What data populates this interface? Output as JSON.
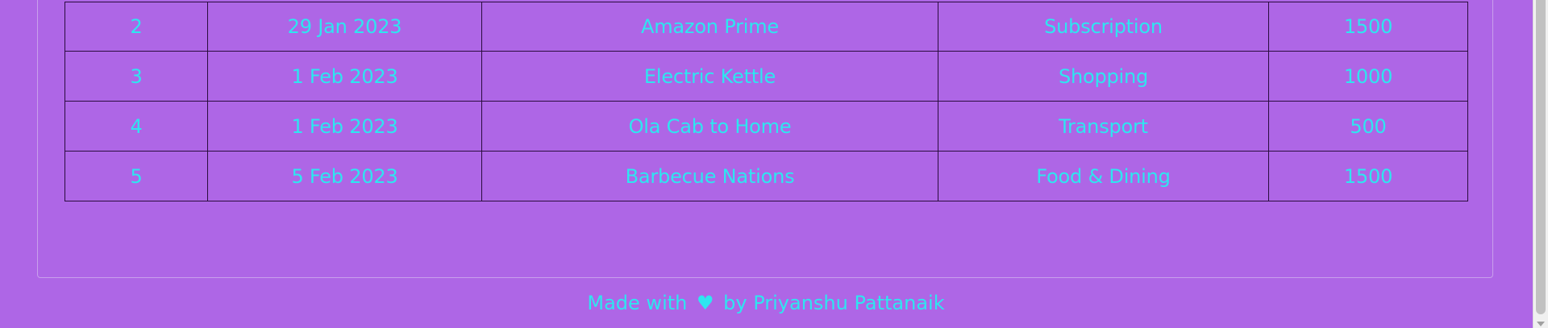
{
  "table": {
    "rows": [
      {
        "id": "2",
        "date": "29 Jan 2023",
        "description": "Amazon Prime",
        "category": "Subscription",
        "amount": "1500"
      },
      {
        "id": "3",
        "date": "1 Feb 2023",
        "description": "Electric Kettle",
        "category": "Shopping",
        "amount": "1000"
      },
      {
        "id": "4",
        "date": "1 Feb 2023",
        "description": "Ola Cab to Home",
        "category": "Transport",
        "amount": "500"
      },
      {
        "id": "5",
        "date": "5 Feb 2023",
        "description": "Barbecue Nations",
        "category": "Food & Dining",
        "amount": "1500"
      }
    ]
  },
  "footer": {
    "prefix": "Made with",
    "heart": "♥",
    "suffix": "by Priyanshu Pattanaik"
  },
  "colors": {
    "background": "#ae66e6",
    "text": "#2ee6f0",
    "table_border": "#2a0c3e"
  }
}
